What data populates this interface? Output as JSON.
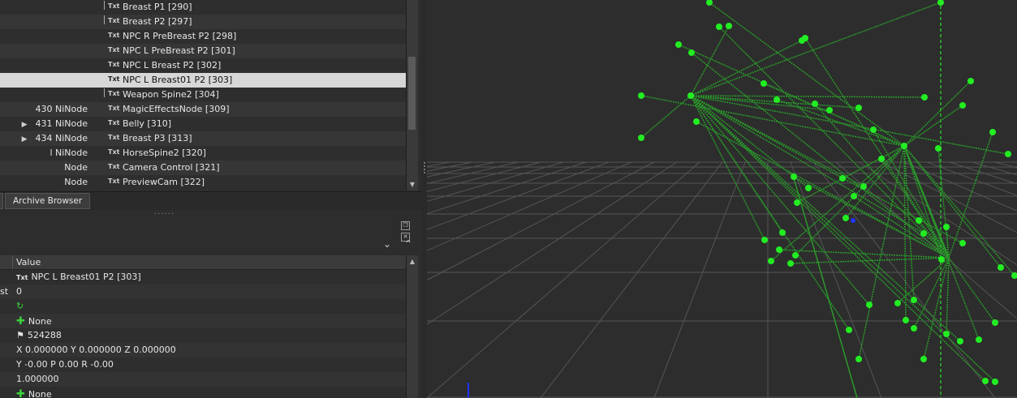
{
  "tree": {
    "rows": [
      {
        "num": "",
        "arrow": "",
        "icon": "Txt",
        "name": "Breast P1 [290]",
        "branch": true
      },
      {
        "num": "",
        "arrow": "",
        "icon": "Txt",
        "name": "Breast P2 [297]",
        "branch": true
      },
      {
        "num": "",
        "arrow": "",
        "icon": "Txt",
        "name": "NPC R PreBreast P2 [298]",
        "branch": false
      },
      {
        "num": "",
        "arrow": "",
        "icon": "Txt",
        "name": "NPC L PreBreast P2 [301]",
        "branch": false
      },
      {
        "num": "",
        "arrow": "",
        "icon": "Txt",
        "name": "NPC L Breast P2 [302]",
        "branch": false
      },
      {
        "num": "",
        "arrow": "",
        "icon": "Txt",
        "name": "NPC L Breast01 P2 [303]",
        "branch": false,
        "selected": true
      },
      {
        "num": "",
        "arrow": "",
        "icon": "Txt",
        "name": "Weapon Spine2 [304]",
        "branch": true
      },
      {
        "num": "430 NiNode",
        "arrow": "",
        "icon": "Txt",
        "name": "MagicEffectsNode [309]",
        "branch": false
      },
      {
        "num": "431 NiNode",
        "arrow": "▶",
        "icon": "Txt",
        "name": "Belly [310]",
        "branch": false
      },
      {
        "num": "434 NiNode",
        "arrow": "▶",
        "icon": "Txt",
        "name": "Breast P3 [313]",
        "branch": false
      },
      {
        "num": "l NiNode",
        "arrow": "",
        "icon": "Txt",
        "name": "HorseSpine2 [320]",
        "branch": false
      },
      {
        "num": "Node",
        "arrow": "",
        "icon": "Txt",
        "name": "Camera Control [321]",
        "branch": false
      },
      {
        "num": "Node",
        "arrow": "",
        "icon": "Txt",
        "name": "PreviewCam [322]",
        "branch": false
      }
    ]
  },
  "tabs": {
    "archive_browser": "Archive Browser"
  },
  "properties": {
    "header_value": "Value",
    "rows": [
      {
        "key": "",
        "icon": "Txt",
        "value": "NPC L Breast01 P2 [303]"
      },
      {
        "key": "st",
        "icon": "",
        "value": "0"
      },
      {
        "key": "",
        "icon": "↻",
        "value": ""
      },
      {
        "key": "",
        "icon": "✚",
        "value": "None"
      },
      {
        "key": "",
        "icon": "⚑",
        "value": "524288"
      },
      {
        "key": "",
        "icon": "",
        "value": "X 0.000000 Y 0.000000 Z 0.000000"
      },
      {
        "key": "",
        "icon": "",
        "value": "Y -0.00 P 0.00 R -0.00"
      },
      {
        "key": "",
        "icon": "",
        "value": "1.000000"
      },
      {
        "key": "",
        "icon": "✚",
        "value": "None"
      }
    ]
  },
  "viewport": {
    "node_color": "#22ee22",
    "link_color": "#2a9a2a",
    "grid_color": "#555555",
    "marker_color": "#2233ff"
  }
}
